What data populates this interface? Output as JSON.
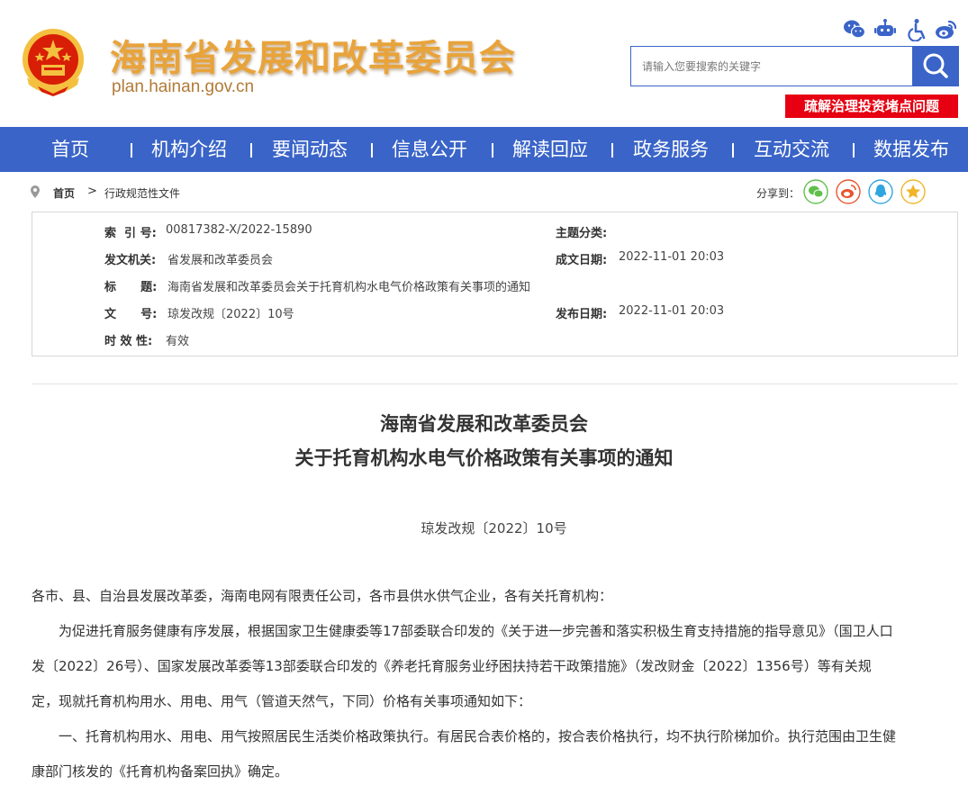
{
  "header": {
    "site_title": "海南省发展和改革委员会",
    "site_domain": "plan.hainan.gov.cn",
    "top_icons": [
      "wechat-icon",
      "robot-icon",
      "accessibility-icon",
      "weibo-icon"
    ],
    "search_placeholder": "请输入您要搜索的关键字",
    "hot_button": "疏解治理投资堵点问题"
  },
  "nav": {
    "items": [
      "首页",
      "机构介绍",
      "要闻动态",
      "信息公开",
      "解读回应",
      "政务服务",
      "互动交流",
      "数据发布"
    ]
  },
  "breadcrumb": {
    "home": "首页",
    "current": "行政规范性文件"
  },
  "share": {
    "label": "分享到：",
    "icons": [
      "wechat-share-icon",
      "weibo-share-icon",
      "qq-share-icon",
      "qzone-share-icon"
    ]
  },
  "info": {
    "index_label": "索  引 号:",
    "index_value": "00817382-X/2022-15890",
    "topic_label": "主题分类:",
    "topic_value": "",
    "issuer_label": "发文机关:",
    "issuer_value": "省发展和改革委员会",
    "created_label": "成文日期:",
    "created_value": "2022-11-01 20:03",
    "title_label": "标      题:",
    "title_value": "海南省发展和改革委员会关于托育机构水电气价格政策有关事项的通知",
    "docno_label": "文      号:",
    "docno_value": "琼发改规〔2022〕10号",
    "published_label": "发布日期:",
    "published_value": "2022-11-01 20:03",
    "validity_label": "时 效 性:",
    "validity_value": "有效"
  },
  "article": {
    "title_line1": "海南省发展和改革委员会",
    "title_line2": "关于托育机构水电气价格政策有关事项的通知",
    "doc_number": "琼发改规〔2022〕10号",
    "lines": [
      "各市、县、自治县发展改革委，海南电网有限责任公司，各市县供水供气企业，各有关托育机构：",
      "为促进托育服务健康有序发展，根据国家卫生健康委等17部委联合印发的《关于进一步完善和落实积极生育支持措施的指导意见》（国卫人口",
      "发〔2022〕26号）、国家发展改革委等13部委联合印发的《养老托育服务业纾困扶持若干政策措施》（发改财金〔2022〕1356号）等有关规",
      "定，现就托育机构用水、用电、用气（管道天然气，下同）价格有关事项通知如下：",
      "一、托育机构用水、用电、用气按照居民生活类价格政策执行。有居民合表价格的，按合表价格执行，均不执行阶梯加价。执行范围由卫生健",
      "康部门核发的《托育机构备案回执》确定。"
    ]
  },
  "colors": {
    "primary_blue": "#3a64c8",
    "title_gold": "#e8a33a",
    "hot_red": "#e60012"
  }
}
